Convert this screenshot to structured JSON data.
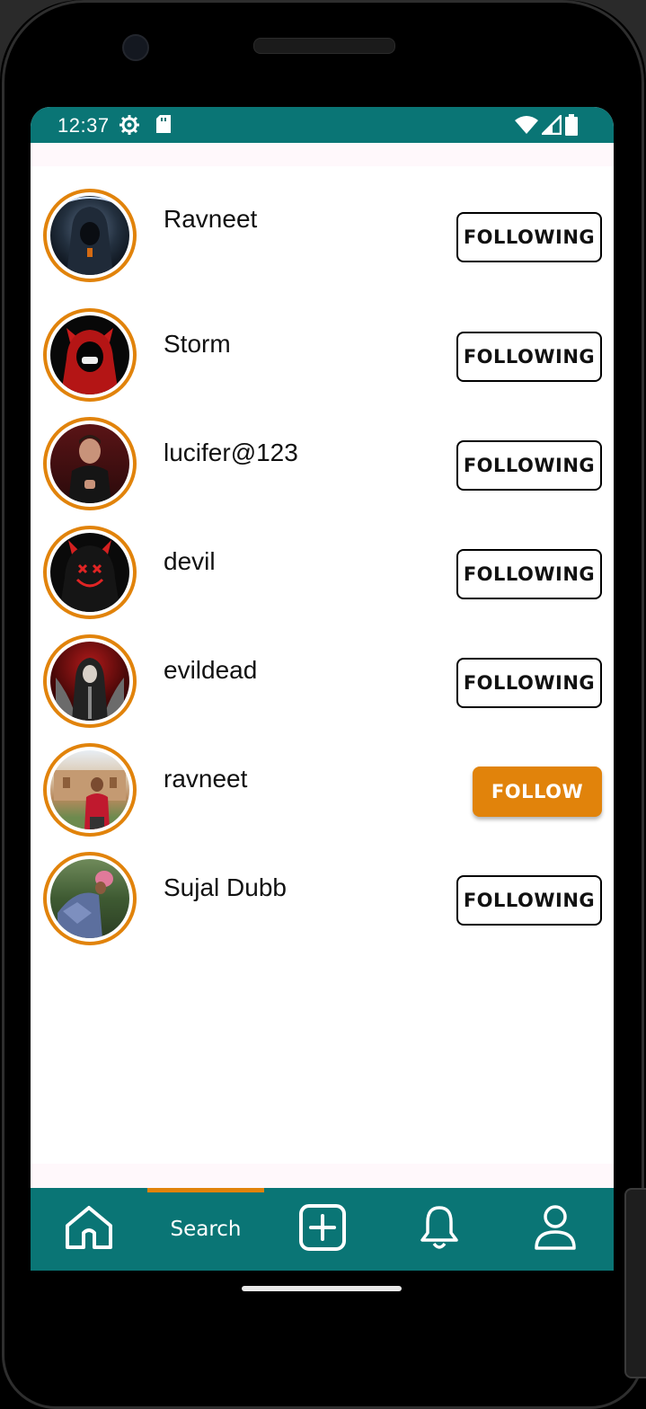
{
  "status_bar": {
    "time": "12:37",
    "left_icons": [
      "gear-icon",
      "sd-card-icon"
    ],
    "right_icons": [
      "wifi-icon",
      "cell-signal-icon",
      "battery-icon"
    ]
  },
  "users": [
    {
      "name": "Ravneet",
      "button": "FOLLOWING",
      "following": true
    },
    {
      "name": "Storm",
      "button": "FOLLOWING",
      "following": true
    },
    {
      "name": "lucifer@123",
      "button": "FOLLOWING",
      "following": true
    },
    {
      "name": "devil",
      "button": "FOLLOWING",
      "following": true
    },
    {
      "name": "evildead",
      "button": "FOLLOWING",
      "following": true
    },
    {
      "name": "ravneet",
      "button": "FOLLOW",
      "following": false
    },
    {
      "name": "Sujal Dubb",
      "button": "FOLLOWING",
      "following": true
    }
  ],
  "bottom_nav": {
    "items": [
      {
        "icon": "home-icon"
      },
      {
        "label": "Search",
        "active": true
      },
      {
        "icon": "add-post-icon"
      },
      {
        "icon": "bell-icon"
      },
      {
        "icon": "profile-icon"
      }
    ]
  },
  "colors": {
    "primary": "#0a7575",
    "accent": "#e1830b"
  }
}
